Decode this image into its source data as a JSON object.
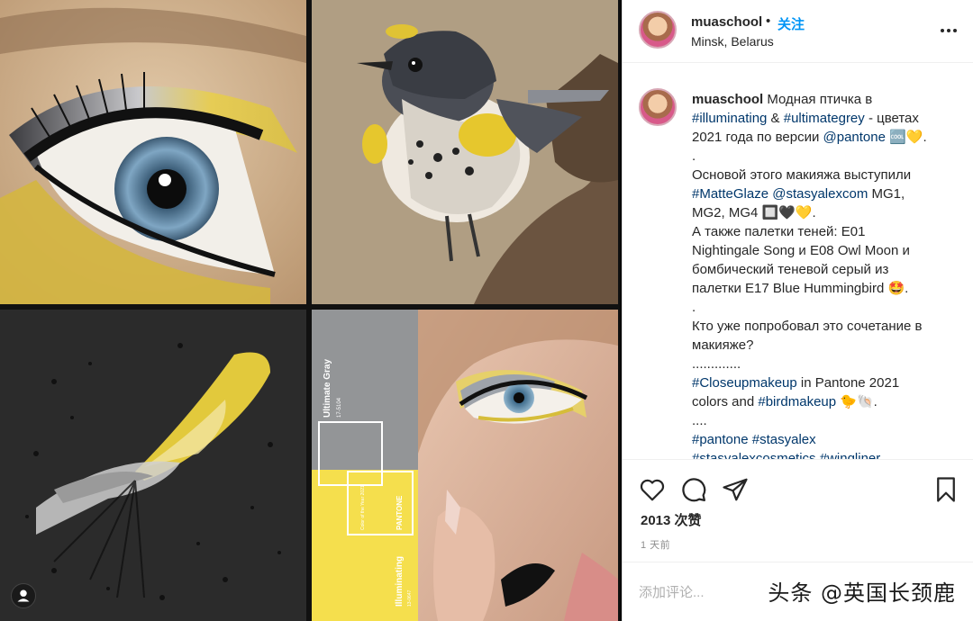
{
  "post": {
    "username": "muaschool",
    "dot": "•",
    "follow_label": "关注",
    "location": "Minsk, Belarus",
    "caption": {
      "username": "muaschool",
      "lines": [
        [
          {
            "t": " Модная птичка в "
          }
        ],
        [
          {
            "t": "#illuminating",
            "tag": true
          },
          {
            "t": " & "
          },
          {
            "t": "#ultimategrey",
            "tag": true
          },
          {
            "t": " - цветах"
          }
        ],
        [
          {
            "t": "2021 года по версии "
          },
          {
            "t": "@pantone",
            "tag": true
          },
          {
            "t": " 🆒💛."
          }
        ],
        [
          {
            "t": "."
          }
        ],
        [
          {
            "t": "Основой этого макияжа выступили"
          }
        ],
        [
          {
            "t": "#MatteGlaze",
            "tag": true
          },
          {
            "t": " "
          },
          {
            "t": "@stasyalexcom",
            "tag": true
          },
          {
            "t": " MG1,"
          }
        ],
        [
          {
            "t": "MG2, MG4 🔲🖤💛."
          }
        ],
        [
          {
            "t": "А также палетки теней: E01"
          }
        ],
        [
          {
            "t": "Nightingale Song и E08 Owl Moon и"
          }
        ],
        [
          {
            "t": "бомбический теневой серый из"
          }
        ],
        [
          {
            "t": "палетки E17 Blue Hummingbird 🤩."
          }
        ],
        [
          {
            "t": "."
          }
        ],
        [
          {
            "t": "Кто уже попробовал это сочетание в"
          }
        ],
        [
          {
            "t": "макияже?"
          }
        ],
        [
          {
            "t": "............."
          }
        ],
        [
          {
            "t": "#Closeupmakeup",
            "tag": true
          },
          {
            "t": " in Pantone 2021"
          }
        ],
        [
          {
            "t": "colors and "
          },
          {
            "t": "#birdmakeup",
            "tag": true
          },
          {
            "t": " 🐤🐚."
          }
        ],
        [
          {
            "t": "...."
          }
        ],
        [
          {
            "t": "#pantone",
            "tag": true
          },
          {
            "t": " "
          },
          {
            "t": "#stasyalex",
            "tag": true
          }
        ],
        [
          {
            "t": "#stasyalexcosmetics",
            "tag": true
          },
          {
            "t": " "
          },
          {
            "t": "#wingliner",
            "tag": true
          }
        ]
      ]
    },
    "likes": "2013 次赞",
    "time": "1 天前",
    "comment_placeholder": "添加评论...",
    "watermark": "头条 @英国长颈鹿"
  },
  "pantone_card": {
    "top_name": "Ultimate Gray",
    "top_code": "17-5104",
    "mid_text": "Color of the Year 2021",
    "brand": "PANTONE",
    "bottom_name": "Illuminating",
    "bottom_code": "13-0647"
  },
  "colors": {
    "link": "#00376b",
    "follow": "#0095f6",
    "ultimate_gray": "#939597",
    "illuminating": "#f5df4d"
  },
  "icons": [
    "heart-icon",
    "comment-icon",
    "share-icon",
    "bookmark-icon",
    "more-icon",
    "user-tag-icon"
  ]
}
